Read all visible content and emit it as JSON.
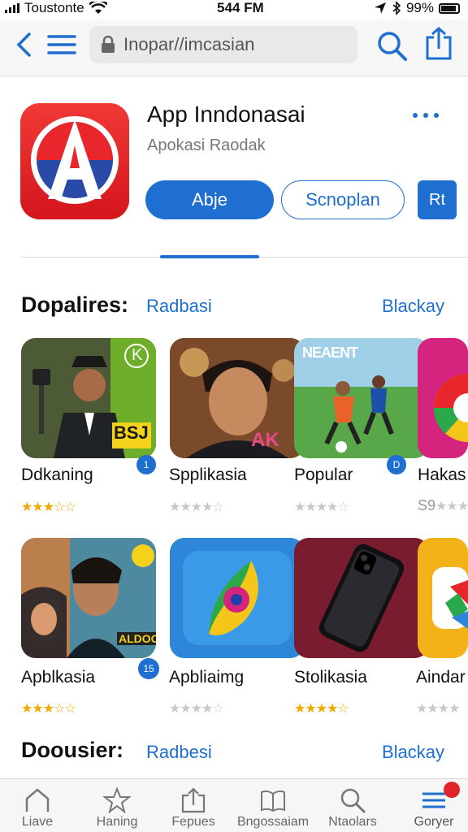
{
  "status_bar": {
    "carrier": "Toustonte",
    "time": "544 FM",
    "battery": "99%"
  },
  "browser": {
    "url": "Inopar//imcasian"
  },
  "app": {
    "title": "App Inndonasai",
    "subtitle": "Apokasi Raodak",
    "primary_button": "Abje",
    "secondary_button": "Scnoplan",
    "square_button": "Rt"
  },
  "section1": {
    "title": "Dopalires:",
    "link1": "Radbasi",
    "link2": "Blackay"
  },
  "row1": [
    {
      "name": "Ddkaning",
      "stars": "★★★☆☆",
      "rating": 3,
      "badge": "1",
      "tag": "BSJ",
      "corner": "K"
    },
    {
      "name": "Spplikasia",
      "stars": "★★★★☆",
      "rating": 4,
      "tag": "AK"
    },
    {
      "name": "Popular",
      "stars": "★★★★☆",
      "rating": 4,
      "badge": "D",
      "banner": "NEAENT"
    },
    {
      "name": "Hakas",
      "stars_label": "S9",
      "stars": "★★★★",
      "rating": 4
    }
  ],
  "row2": [
    {
      "name": "Apblkasia",
      "stars": "★★★☆☆",
      "rating": 3,
      "badge": "15",
      "banner": "ALDOOT"
    },
    {
      "name": "Apbliaimg",
      "stars": "★★★★☆",
      "rating": 4
    },
    {
      "name": "Stolikasia",
      "stars": "★★★★☆",
      "rating": 4
    },
    {
      "name": "Aindar",
      "stars": "★★★★",
      "rating": 4
    }
  ],
  "section2": {
    "title": "Doousier:",
    "link1": "Radbesi",
    "link2": "Blackay"
  },
  "tabs": [
    {
      "label": "Liave",
      "icon": "home-icon"
    },
    {
      "label": "Haning",
      "icon": "star-icon"
    },
    {
      "label": "Fepues",
      "icon": "upload-icon"
    },
    {
      "label": "Bngossaiam",
      "icon": "book-icon"
    },
    {
      "label": "Ntaolars",
      "icon": "search-icon"
    },
    {
      "label": "Goryer",
      "icon": "list-icon"
    }
  ],
  "colors": {
    "accent": "#1e6fd0",
    "star": "#f2a900",
    "star_empty": "#c8c8c8",
    "badge_red": "#e0262a"
  }
}
